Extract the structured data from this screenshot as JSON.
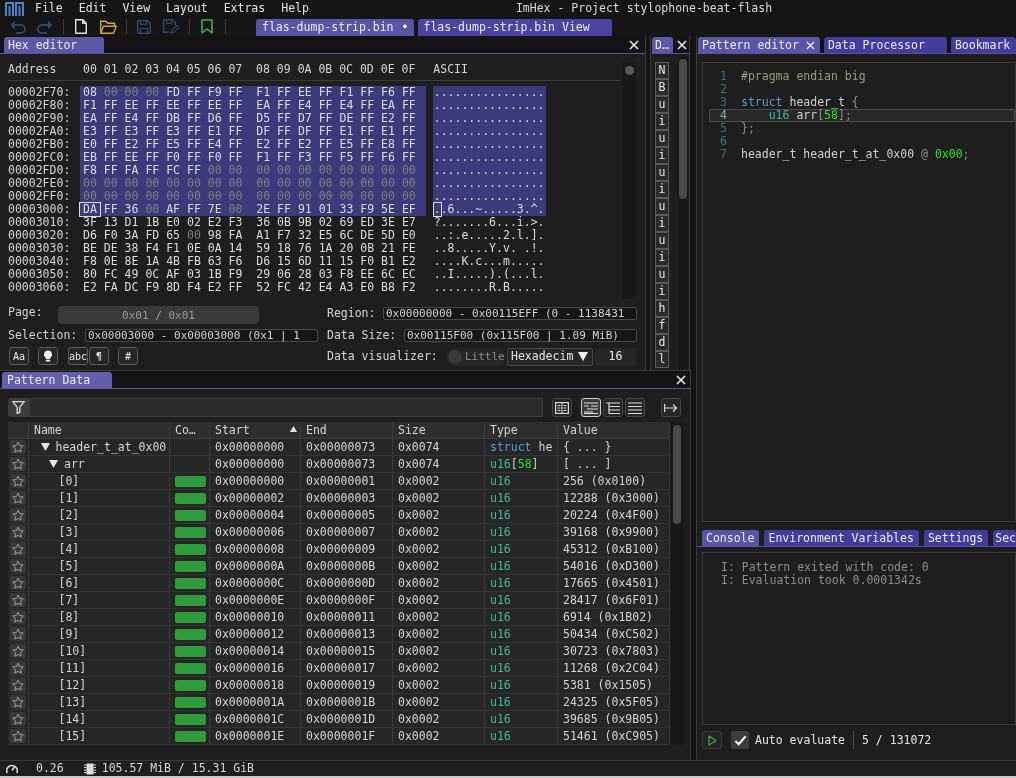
{
  "menu_bar": {
    "items": [
      "File",
      "Edit",
      "View",
      "Layout",
      "Extras",
      "Help"
    ],
    "title": "ImHex - Project stylophone-beat-flash"
  },
  "toolbar": {
    "groups": [
      [
        {
          "kind": "undo",
          "disabled": true
        },
        {
          "kind": "redo",
          "disabled": true
        }
      ],
      [
        {
          "kind": "new_file",
          "disabled": false
        },
        {
          "kind": "open_folder",
          "disabled": false
        }
      ],
      [
        {
          "kind": "save",
          "disabled": true
        },
        {
          "kind": "save_as",
          "disabled": true
        }
      ],
      [
        {
          "kind": "bookmark",
          "disabled": false
        }
      ]
    ],
    "file_tabs": [
      {
        "label": "flas-dump-strip.bin",
        "marker": "•",
        "selected": true
      },
      {
        "label": "flas-dump-strip.bin View",
        "selected": false
      }
    ]
  },
  "hex_editor": {
    "tab": "Hex editor",
    "header": {
      "address": "Address",
      "columns": [
        "00",
        "01",
        "02",
        "03",
        "04",
        "05",
        "06",
        "07",
        "08",
        "09",
        "0A",
        "0B",
        "0C",
        "0D",
        "0E",
        "0F"
      ],
      "ascii": "ASCII"
    },
    "rows": [
      {
        "address": "00002F70:",
        "bytes": [
          "08",
          "00",
          "00",
          "00",
          "FD",
          "FF",
          "F9",
          "FF",
          "F1",
          "FF",
          "EE",
          "FF",
          "F1",
          "FF",
          "F6",
          "FF"
        ],
        "ascii": "................",
        "highlighted": true,
        "cursor": false
      },
      {
        "address": "00002F80:",
        "bytes": [
          "F1",
          "FF",
          "EE",
          "FF",
          "EE",
          "FF",
          "EE",
          "FF",
          "EA",
          "FF",
          "E4",
          "FF",
          "E4",
          "FF",
          "EA",
          "FF"
        ],
        "ascii": "................",
        "highlighted": true,
        "cursor": false
      },
      {
        "address": "00002F90:",
        "bytes": [
          "EA",
          "FF",
          "E4",
          "FF",
          "DB",
          "FF",
          "D6",
          "FF",
          "D5",
          "FF",
          "D7",
          "FF",
          "DE",
          "FF",
          "E2",
          "FF"
        ],
        "ascii": "................",
        "highlighted": true,
        "cursor": false
      },
      {
        "address": "00002FA0:",
        "bytes": [
          "E3",
          "FF",
          "E3",
          "FF",
          "E3",
          "FF",
          "E1",
          "FF",
          "DF",
          "FF",
          "DF",
          "FF",
          "E1",
          "FF",
          "E1",
          "FF"
        ],
        "ascii": "................",
        "highlighted": true,
        "cursor": false
      },
      {
        "address": "00002FB0:",
        "bytes": [
          "E0",
          "FF",
          "E2",
          "FF",
          "E5",
          "FF",
          "E4",
          "FF",
          "E2",
          "FF",
          "E2",
          "FF",
          "E5",
          "FF",
          "E8",
          "FF"
        ],
        "ascii": "................",
        "highlighted": true,
        "cursor": false
      },
      {
        "address": "00002FC0:",
        "bytes": [
          "EB",
          "FF",
          "EE",
          "FF",
          "F0",
          "FF",
          "F0",
          "FF",
          "F1",
          "FF",
          "F3",
          "FF",
          "F5",
          "FF",
          "F6",
          "FF"
        ],
        "ascii": "................",
        "highlighted": true,
        "cursor": false
      },
      {
        "address": "00002FD0:",
        "bytes": [
          "F8",
          "FF",
          "FA",
          "FF",
          "FC",
          "FF",
          "00",
          "00",
          "00",
          "00",
          "00",
          "00",
          "00",
          "00",
          "00",
          "00"
        ],
        "ascii": "................",
        "highlighted": true,
        "cursor": false
      },
      {
        "address": "00002FE0:",
        "bytes": [
          "00",
          "00",
          "00",
          "00",
          "00",
          "00",
          "00",
          "00",
          "00",
          "00",
          "00",
          "00",
          "00",
          "00",
          "00",
          "00"
        ],
        "ascii": "................",
        "highlighted": true,
        "cursor": false
      },
      {
        "address": "00002FF0:",
        "bytes": [
          "00",
          "00",
          "00",
          "00",
          "00",
          "00",
          "00",
          "00",
          "00",
          "00",
          "00",
          "00",
          "00",
          "00",
          "00",
          "00"
        ],
        "ascii": "................",
        "highlighted": true,
        "cursor": false
      },
      {
        "address": "00003000:",
        "bytes": [
          "DA",
          "FF",
          "36",
          "00",
          "AF",
          "FF",
          "7E",
          "00",
          "2E",
          "FF",
          "91",
          "01",
          "33",
          "F9",
          "5E",
          "EF"
        ],
        "ascii": "..6...~.....3.^.",
        "highlighted": true,
        "cursor": true
      },
      {
        "address": "00003010:",
        "bytes": [
          "3F",
          "13",
          "D1",
          "1B",
          "E0",
          "02",
          "E2",
          "F3",
          "36",
          "0B",
          "9B",
          "02",
          "69",
          "ED",
          "3E",
          "E7"
        ],
        "ascii": "?.......6...i.>.",
        "highlighted": false,
        "cursor": false
      },
      {
        "address": "00003020:",
        "bytes": [
          "D6",
          "F0",
          "3A",
          "FD",
          "65",
          "00",
          "98",
          "FA",
          "A1",
          "F7",
          "32",
          "E5",
          "6C",
          "DE",
          "5D",
          "E0"
        ],
        "ascii": "..:.e.....2.l.].",
        "highlighted": false,
        "cursor": false
      },
      {
        "address": "00003030:",
        "bytes": [
          "BE",
          "DE",
          "38",
          "F4",
          "F1",
          "0E",
          "0A",
          "14",
          "59",
          "18",
          "76",
          "1A",
          "20",
          "0B",
          "21",
          "FE"
        ],
        "ascii": "..8.....Y.v. .!.",
        "highlighted": false,
        "cursor": false
      },
      {
        "address": "00003040:",
        "bytes": [
          "F8",
          "0E",
          "8E",
          "1A",
          "4B",
          "FB",
          "63",
          "F6",
          "D6",
          "15",
          "6D",
          "11",
          "15",
          "F0",
          "B1",
          "E2"
        ],
        "ascii": "....K.c...m.....",
        "highlighted": false,
        "cursor": false
      },
      {
        "address": "00003050:",
        "bytes": [
          "80",
          "FC",
          "49",
          "0C",
          "AF",
          "03",
          "1B",
          "F9",
          "29",
          "06",
          "28",
          "03",
          "F8",
          "EE",
          "6C",
          "EC"
        ],
        "ascii": "..I.....).(...l.",
        "highlighted": false,
        "cursor": false
      },
      {
        "address": "00003060:",
        "bytes": [
          "E2",
          "FA",
          "DC",
          "F9",
          "8D",
          "F4",
          "E2",
          "FF",
          "52",
          "FC",
          "42",
          "E4",
          "A3",
          "E0",
          "B8",
          "F2"
        ],
        "ascii": "........R.B.....",
        "highlighted": false,
        "cursor": false
      }
    ],
    "page": {
      "label": "Page:",
      "value": "0x01 / 0x01"
    },
    "selection": {
      "label": "Selection:",
      "value": "0x00003000 - 0x00003000 (0x1 | 1"
    },
    "tool_buttons": [
      {
        "kind": "text",
        "label": "Aa"
      },
      {
        "kind": "bulb"
      },
      {
        "kind": "text",
        "label": "abc"
      },
      {
        "kind": "text",
        "label": "¶"
      },
      {
        "kind": "text",
        "label": "#"
      }
    ],
    "region": {
      "label": "Region:",
      "value": "0x00000000 - 0x00115EFF (0 - 1138431"
    },
    "data_size": {
      "label": "Data Size:",
      "value": "0x00115F00 (0x115F00 | 1.09 MiB)"
    },
    "data_visualizer": {
      "label": "Data visualizer:",
      "toggle_label": "Little",
      "dropdown_value": "Hexadecim",
      "number_value": "16"
    }
  },
  "narrow_panel": {
    "tab": "D…",
    "buttons": [
      "N",
      "B",
      "u",
      "i",
      "u",
      "i",
      "u",
      "i",
      "u",
      "i",
      "u",
      "i",
      "u",
      "i",
      "h",
      "f",
      "d",
      "l"
    ]
  },
  "pattern_data": {
    "tab": "Pattern Data",
    "view_buttons": [
      {
        "kind": "columns",
        "selected": false
      },
      {
        "kind": "indented_list",
        "selected": true
      },
      {
        "kind": "tree",
        "selected": false
      },
      {
        "kind": "list",
        "selected": false
      }
    ],
    "columns": [
      {
        "label": "Name",
        "sorted": false
      },
      {
        "label": "Co…",
        "sorted": false
      },
      {
        "label": "Start",
        "sorted": true
      },
      {
        "label": "End",
        "sorted": false
      },
      {
        "label": "Size",
        "sorted": false
      },
      {
        "label": "Type",
        "sorted": false
      },
      {
        "label": "Value",
        "sorted": false
      }
    ],
    "rows": [
      {
        "name": "header_t_at_0x00",
        "expanded": true,
        "start": "0x00000000",
        "end": "0x00000073",
        "size": "0x0074",
        "type": [
          {
            "kind": "keyword",
            "text": "struct"
          },
          {
            "kind": "plain",
            "text": " he"
          }
        ],
        "value": "{ ... }",
        "children": [
          {
            "name": "arr",
            "expanded": true,
            "start": "0x00000000",
            "end": "0x00000073",
            "size": "0x0074",
            "type": [
              {
                "kind": "type",
                "text": "u16"
              },
              {
                "kind": "plain",
                "text": "["
              },
              {
                "kind": "number",
                "text": "58"
              },
              {
                "kind": "plain",
                "text": "]"
              }
            ],
            "value": "[ ... ]",
            "children": [
              {
                "name": "[0]",
                "color": "#2e9c3a",
                "start": "0x00000000",
                "end": "0x00000001",
                "size": "0x0002",
                "type": [
                  {
                    "kind": "type",
                    "text": "u16"
                  }
                ],
                "value": "256 (0x0100)"
              },
              {
                "name": "[1]",
                "color": "#2e9c3a",
                "start": "0x00000002",
                "end": "0x00000003",
                "size": "0x0002",
                "type": [
                  {
                    "kind": "type",
                    "text": "u16"
                  }
                ],
                "value": "12288 (0x3000)"
              },
              {
                "name": "[2]",
                "color": "#2e9c3a",
                "start": "0x00000004",
                "end": "0x00000005",
                "size": "0x0002",
                "type": [
                  {
                    "kind": "type",
                    "text": "u16"
                  }
                ],
                "value": "20224 (0x4F00)"
              },
              {
                "name": "[3]",
                "color": "#2e9c3a",
                "start": "0x00000006",
                "end": "0x00000007",
                "size": "0x0002",
                "type": [
                  {
                    "kind": "type",
                    "text": "u16"
                  }
                ],
                "value": "39168 (0x9900)"
              },
              {
                "name": "[4]",
                "color": "#2e9c3a",
                "start": "0x00000008",
                "end": "0x00000009",
                "size": "0x0002",
                "type": [
                  {
                    "kind": "type",
                    "text": "u16"
                  }
                ],
                "value": "45312 (0xB100)"
              },
              {
                "name": "[5]",
                "color": "#2e9c3a",
                "start": "0x0000000A",
                "end": "0x0000000B",
                "size": "0x0002",
                "type": [
                  {
                    "kind": "type",
                    "text": "u16"
                  }
                ],
                "value": "54016 (0xD300)"
              },
              {
                "name": "[6]",
                "color": "#2e9c3a",
                "start": "0x0000000C",
                "end": "0x0000000D",
                "size": "0x0002",
                "type": [
                  {
                    "kind": "type",
                    "text": "u16"
                  }
                ],
                "value": "17665 (0x4501)"
              },
              {
                "name": "[7]",
                "color": "#2e9c3a",
                "start": "0x0000000E",
                "end": "0x0000000F",
                "size": "0x0002",
                "type": [
                  {
                    "kind": "type",
                    "text": "u16"
                  }
                ],
                "value": "28417 (0x6F01)"
              },
              {
                "name": "[8]",
                "color": "#2e9c3a",
                "start": "0x00000010",
                "end": "0x00000011",
                "size": "0x0002",
                "type": [
                  {
                    "kind": "type",
                    "text": "u16"
                  }
                ],
                "value": "6914 (0x1B02)"
              },
              {
                "name": "[9]",
                "color": "#2e9c3a",
                "start": "0x00000012",
                "end": "0x00000013",
                "size": "0x0002",
                "type": [
                  {
                    "kind": "type",
                    "text": "u16"
                  }
                ],
                "value": "50434 (0xC502)"
              },
              {
                "name": "[10]",
                "color": "#2e9c3a",
                "start": "0x00000014",
                "end": "0x00000015",
                "size": "0x0002",
                "type": [
                  {
                    "kind": "type",
                    "text": "u16"
                  }
                ],
                "value": "30723 (0x7803)"
              },
              {
                "name": "[11]",
                "color": "#2e9c3a",
                "start": "0x00000016",
                "end": "0x00000017",
                "size": "0x0002",
                "type": [
                  {
                    "kind": "type",
                    "text": "u16"
                  }
                ],
                "value": "11268 (0x2C04)"
              },
              {
                "name": "[12]",
                "color": "#2e9c3a",
                "start": "0x00000018",
                "end": "0x00000019",
                "size": "0x0002",
                "type": [
                  {
                    "kind": "type",
                    "text": "u16"
                  }
                ],
                "value": "5381 (0x1505)"
              },
              {
                "name": "[13]",
                "color": "#2e9c3a",
                "start": "0x0000001A",
                "end": "0x0000001B",
                "size": "0x0002",
                "type": [
                  {
                    "kind": "type",
                    "text": "u16"
                  }
                ],
                "value": "24325 (0x5F05)"
              },
              {
                "name": "[14]",
                "color": "#2e9c3a",
                "start": "0x0000001C",
                "end": "0x0000001D",
                "size": "0x0002",
                "type": [
                  {
                    "kind": "type",
                    "text": "u16"
                  }
                ],
                "value": "39685 (0x9B05)"
              },
              {
                "name": "[15]",
                "color": "#2e9c3a",
                "start": "0x0000001E",
                "end": "0x0000001F",
                "size": "0x0002",
                "type": [
                  {
                    "kind": "type",
                    "text": "u16"
                  }
                ],
                "value": "51461 (0xC905)"
              }
            ]
          }
        ]
      }
    ]
  },
  "pattern_editor": {
    "tabs": [
      {
        "label": "Pattern editor",
        "selected": true
      },
      {
        "label": "Data Processor",
        "selected": false
      },
      {
        "label": "Bookmark",
        "selected": false
      }
    ],
    "lines": [
      {
        "number": "1",
        "highlighted": false,
        "tokens": [
          {
            "kind": "directive",
            "text": "#pragma endian big"
          }
        ]
      },
      {
        "number": "2",
        "highlighted": false
      },
      {
        "number": "3",
        "highlighted": false,
        "tokens": [
          {
            "kind": "keyword",
            "text": "struct"
          },
          {
            "kind": "plain",
            "text": " header_t "
          },
          {
            "kind": "punct",
            "text": "{"
          }
        ]
      },
      {
        "number": "4",
        "highlighted": true,
        "tokens": [
          {
            "kind": "type",
            "text": "    u16"
          },
          {
            "kind": "plain",
            "text": " arr"
          },
          {
            "kind": "punct",
            "text": "["
          },
          {
            "kind": "number",
            "text": "58"
          },
          {
            "kind": "punct",
            "text": "];"
          }
        ]
      },
      {
        "number": "5",
        "highlighted": false,
        "tokens": [
          {
            "kind": "punct",
            "text": "};"
          }
        ]
      },
      {
        "number": "6",
        "highlighted": false
      },
      {
        "number": "7",
        "highlighted": false,
        "tokens": [
          {
            "kind": "plain",
            "text": "header_t header_t_at_0x00 "
          },
          {
            "kind": "punct",
            "text": "@ "
          },
          {
            "kind": "number",
            "text": "0x00"
          },
          {
            "kind": "punct",
            "text": ";"
          }
        ]
      }
    ]
  },
  "console": {
    "tabs": [
      {
        "label": "Console",
        "selected": true
      },
      {
        "label": "Environment Variables",
        "selected": false
      },
      {
        "label": "Settings",
        "selected": false
      },
      {
        "label": "Sec",
        "selected": false
      }
    ],
    "lines": [
      "I: Pattern exited with code: 0",
      "I: Evaluation took 0.0001342s"
    ],
    "auto_evaluate": {
      "label": "Auto evaluate",
      "checked": true
    },
    "count": "5 / 131072"
  },
  "status_bar": {
    "items": [
      {
        "kind": "gauge",
        "text": "0.26"
      },
      {
        "kind": "chip",
        "text": "105.57 MiB / 15.31 GiB"
      }
    ]
  }
}
